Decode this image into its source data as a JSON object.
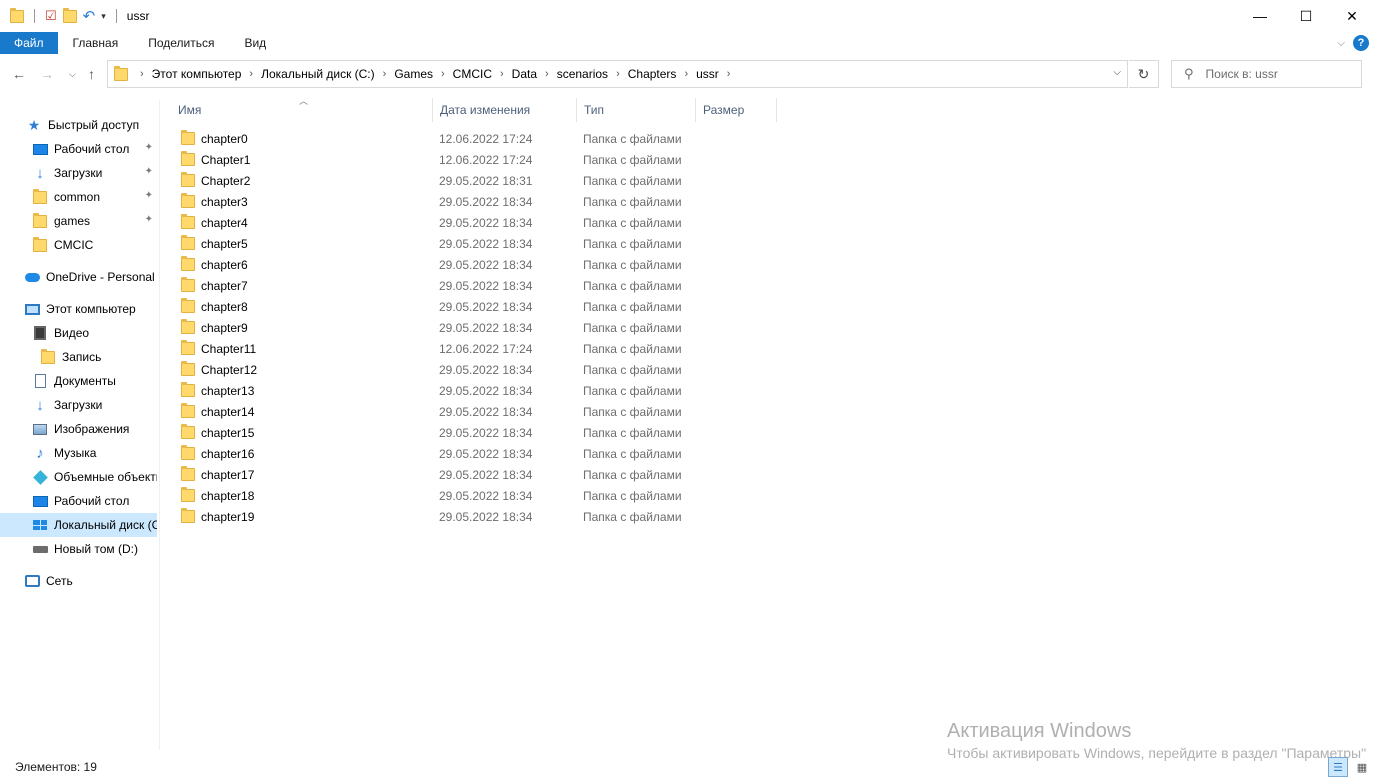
{
  "window": {
    "title": "ussr",
    "controls": [
      "—",
      "☐",
      "✕"
    ]
  },
  "ribbon": {
    "tabs": [
      "Файл",
      "Главная",
      "Поделиться",
      "Вид"
    ],
    "help": "?"
  },
  "address": {
    "crumbs": [
      "Этот компьютер",
      "Локальный диск (C:)",
      "Games",
      "CMCIC",
      "Data",
      "scenarios",
      "Chapters",
      "ussr"
    ]
  },
  "search": {
    "placeholder": "Поиск в: ussr"
  },
  "sidebar": {
    "quick_access": "Быстрый доступ",
    "quick_items": [
      {
        "label": "Рабочий стол",
        "icon": "desktop-icon"
      },
      {
        "label": "Загрузки",
        "icon": "downloads-icon"
      },
      {
        "label": "common",
        "icon": "folder-icon"
      },
      {
        "label": "games",
        "icon": "folder-icon"
      },
      {
        "label": "CMCIC",
        "icon": "folder-icon"
      }
    ],
    "onedrive": "OneDrive - Personal",
    "this_pc": "Этот компьютер",
    "pc_items": [
      {
        "label": "Видео",
        "icon": "video-icon"
      },
      {
        "label": "Запись",
        "icon": "folder-icon"
      },
      {
        "label": "Документы",
        "icon": "documents-icon"
      },
      {
        "label": "Загрузки",
        "icon": "downloads-icon"
      },
      {
        "label": "Изображения",
        "icon": "pictures-icon"
      },
      {
        "label": "Музыка",
        "icon": "music-icon"
      },
      {
        "label": "Объемные объекты",
        "icon": "3d-objects-icon"
      },
      {
        "label": "Рабочий стол",
        "icon": "desktop-icon"
      },
      {
        "label": "Локальный диск (C:)",
        "icon": "system-drive-icon"
      },
      {
        "label": "Новый том (D:)",
        "icon": "drive-icon"
      }
    ],
    "network": "Сеть"
  },
  "columns": {
    "name": "Имя",
    "date": "Дата изменения",
    "type": "Тип",
    "size": "Размер"
  },
  "files": [
    {
      "name": "chapter0",
      "date": "12.06.2022 17:24",
      "type": "Папка с файлами"
    },
    {
      "name": "Chapter1",
      "date": "12.06.2022 17:24",
      "type": "Папка с файлами"
    },
    {
      "name": "Chapter2",
      "date": "29.05.2022 18:31",
      "type": "Папка с файлами"
    },
    {
      "name": "chapter3",
      "date": "29.05.2022 18:34",
      "type": "Папка с файлами"
    },
    {
      "name": "chapter4",
      "date": "29.05.2022 18:34",
      "type": "Папка с файлами"
    },
    {
      "name": "chapter5",
      "date": "29.05.2022 18:34",
      "type": "Папка с файлами"
    },
    {
      "name": "chapter6",
      "date": "29.05.2022 18:34",
      "type": "Папка с файлами"
    },
    {
      "name": "chapter7",
      "date": "29.05.2022 18:34",
      "type": "Папка с файлами"
    },
    {
      "name": "chapter8",
      "date": "29.05.2022 18:34",
      "type": "Папка с файлами"
    },
    {
      "name": "chapter9",
      "date": "29.05.2022 18:34",
      "type": "Папка с файлами"
    },
    {
      "name": "Chapter11",
      "date": "12.06.2022 17:24",
      "type": "Папка с файлами"
    },
    {
      "name": "Chapter12",
      "date": "29.05.2022 18:34",
      "type": "Папка с файлами"
    },
    {
      "name": "chapter13",
      "date": "29.05.2022 18:34",
      "type": "Папка с файлами"
    },
    {
      "name": "chapter14",
      "date": "29.05.2022 18:34",
      "type": "Папка с файлами"
    },
    {
      "name": "chapter15",
      "date": "29.05.2022 18:34",
      "type": "Папка с файлами"
    },
    {
      "name": "chapter16",
      "date": "29.05.2022 18:34",
      "type": "Папка с файлами"
    },
    {
      "name": "chapter17",
      "date": "29.05.2022 18:34",
      "type": "Папка с файлами"
    },
    {
      "name": "chapter18",
      "date": "29.05.2022 18:34",
      "type": "Папка с файлами"
    },
    {
      "name": "chapter19",
      "date": "29.05.2022 18:34",
      "type": "Папка с файлами"
    }
  ],
  "status": {
    "count_text": "Элементов: 19"
  },
  "watermark": {
    "line1": "Активация Windows",
    "line2": "Чтобы активировать Windows, перейдите в раздел \"Параметры\""
  },
  "colors": {
    "accent": "#1979ca",
    "selected": "#cce8ff",
    "folder": "#ffd96b",
    "secondary_text": "#6d6d6d"
  }
}
